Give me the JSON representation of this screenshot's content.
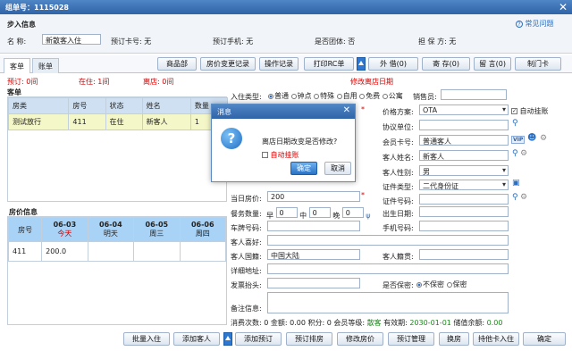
{
  "window": {
    "title": "组单号：1115028",
    "close": "✕"
  },
  "info": {
    "section_title": "步入信息",
    "help_link": "常见问题",
    "name_label": "名    称:",
    "name_value": "新散客入住",
    "prepay_card": "预订卡号: 无",
    "prepay_phone": "预订手机: 无",
    "is_group": "是否团体: 否",
    "guarantor": "担 保 方: 无"
  },
  "tabs": {
    "guest": "客单",
    "bill": "账单"
  },
  "toolbar": {
    "products": "商品部",
    "price_log": "房价变更记录",
    "op_log": "操作记录",
    "print_rc": "打印RC单",
    "outside_call": "外 借(0)",
    "deposit": "寄 存(0)",
    "message": "留 言(0)",
    "make_card": "制门卡"
  },
  "status": {
    "reserved": "预订: 0间",
    "in_house": "在住: 1间",
    "checked_out": "离店: 0间",
    "modify_date": "修改离店日期"
  },
  "guest_table": {
    "title": "客单",
    "headers": [
      "房类",
      "房号",
      "状态",
      "姓名",
      "数量"
    ],
    "row": [
      "测试放行",
      "411",
      "在住",
      "新客人",
      "1"
    ]
  },
  "price_info": {
    "title": "房价信息",
    "headers": [
      {
        "date": "06-03",
        "day": "今天"
      },
      {
        "date": "06-04",
        "day": "明天"
      },
      {
        "date": "06-05",
        "day": "周三"
      },
      {
        "date": "06-06",
        "day": "周四"
      }
    ],
    "room_header": "房号",
    "row": [
      "411",
      "200.0"
    ]
  },
  "form": {
    "checkin_type": "入住类型:",
    "types": [
      "普通",
      "钟点",
      "特殊",
      "自用",
      "免费",
      "公寓"
    ],
    "salesman": "销售员:",
    "price_plan": "价格方案:",
    "price_plan_value": "OTA",
    "auto_hang": "自动挂账",
    "agreement": "协议单位:",
    "member_card": "会员卡号:",
    "member_card_value": "普通客人",
    "vip": "VIP",
    "guest_name": "客人姓名:",
    "guest_name_value": "新客人",
    "guest_gender": "客人性别:",
    "gender_value": "男",
    "id_type": "证件类型:",
    "id_type_value": "二代身份证",
    "id_no": "证件号码:",
    "current_price": "当日房价:",
    "current_price_value": "200",
    "birth": "出生日期:",
    "breakfast": "餐务数量:",
    "meals": [
      {
        "label": "早",
        "value": "0"
      },
      {
        "label": "中",
        "value": "0"
      },
      {
        "label": "晚",
        "value": "0"
      }
    ],
    "plate": "车牌号码:",
    "phone": "手机号码:",
    "hobby": "客人喜好:",
    "nationality": "客人国籍:",
    "nationality_value": "中国大陆",
    "origin": "客人籍贯:",
    "address": "详细地址:",
    "invoice": "发票抬头:",
    "secret": "是否保密:",
    "secret_opts": [
      "不保密",
      "保密"
    ],
    "remark": "备注信息:"
  },
  "footer_info": {
    "text1": "消费次数: 0 金额: 0.00 积分: 0 会员等级:",
    "level": "散客",
    "text2": "有效期:",
    "expire": "2030-01-01",
    "text3": "储值余额:",
    "balance": "0.00"
  },
  "bottom_buttons": {
    "batch": "批量入住",
    "add_guest": "添加客人",
    "add_prepay": "添加预订",
    "prepay_room": "预订排房",
    "modify_price": "修改房价",
    "prepay_manage": "预订管理",
    "change_room": "换房",
    "card_checkin": "持他卡入住",
    "confirm": "确定"
  },
  "dialog": {
    "title": "消息",
    "message": "离店日期改变是否修改?",
    "auto_hang": "自动挂账",
    "ok": "确定",
    "cancel": "取消"
  },
  "icons": {
    "info": "info-question-icon",
    "search": "search-icon"
  }
}
